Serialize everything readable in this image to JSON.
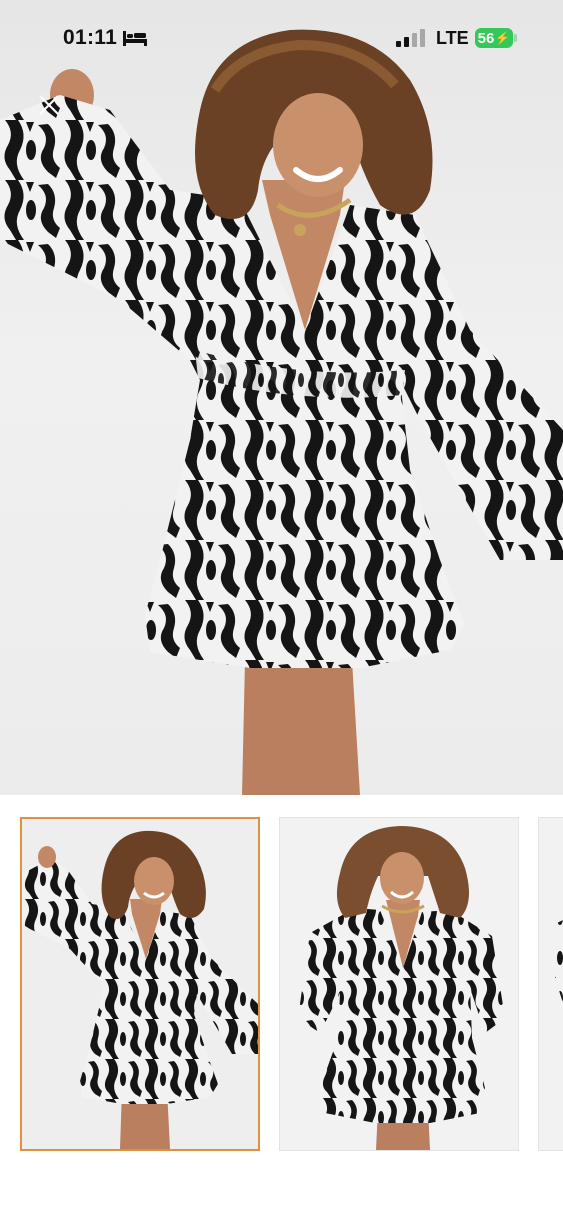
{
  "status_bar": {
    "time": "01:11",
    "sleep_icon": "bed-icon",
    "signal_icon": "signal-bars-icon",
    "network": "LTE",
    "battery_level": "56",
    "battery_color": "#34c759"
  },
  "viewer": {
    "close_icon": "close-icon",
    "main_image_icon": "product-photo-dress",
    "accent_color": "#e0913d"
  },
  "thumbnails": [
    {
      "icon": "product-photo-dress-pose-1",
      "selected": true
    },
    {
      "icon": "product-photo-dress-pose-2",
      "selected": false
    },
    {
      "icon": "product-photo-dress-pose-3",
      "selected": false
    }
  ]
}
